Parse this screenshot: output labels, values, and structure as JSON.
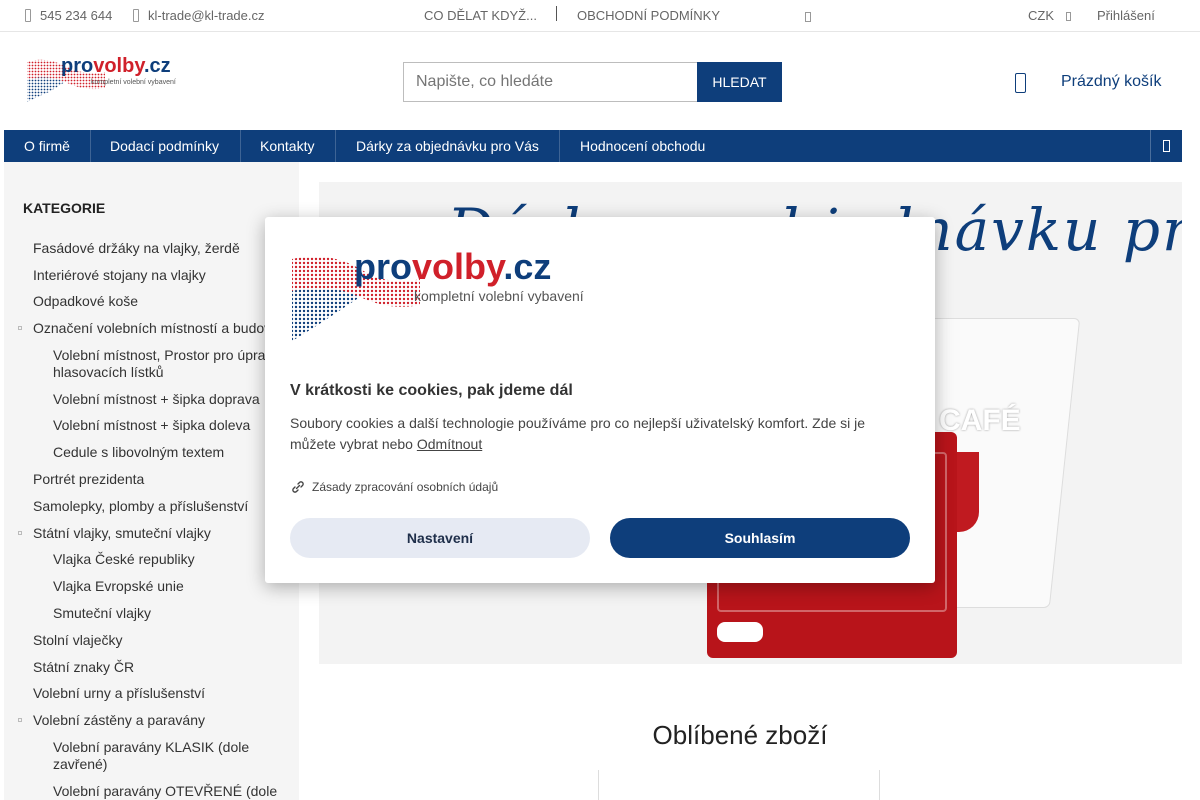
{
  "topbar": {
    "phone": "545 234 644",
    "email": "kl-trade@kl-trade.cz",
    "links": [
      "CO DĚLAT KDYŽ...",
      "OBCHODNÍ PODMÍNKY"
    ],
    "currency": "CZK",
    "login": "Přihlášení"
  },
  "logo": {
    "brand_part1": "pro",
    "brand_part2": "volby",
    "brand_part3": ".cz",
    "tagline": "kompletní volební vybavení"
  },
  "search": {
    "placeholder": "Napište, co hledáte",
    "button": "HLEDAT"
  },
  "cart": {
    "label": "Prázdný košík"
  },
  "nav": {
    "items": [
      "O firmě",
      "Dodací podmínky",
      "Kontakty",
      "Dárky za objednávku pro Vás",
      "Hodnocení obchodu"
    ]
  },
  "sidebar": {
    "title": "KATEGORIE",
    "categories": [
      "Fasádové držáky na vlajky, žerdě",
      "Interiérové stojany na vlajky",
      "Odpadkové koše",
      "Označení volebních místností a budov",
      "Volební místnost, Prostor pro úpravu hlasovacích lístků",
      "Volební místnost + šipka doprava",
      "Volební místnost + šipka doleva",
      "Cedule s libovolným textem",
      "Portrét prezidenta",
      "Samolepky, plomby a příslušenství",
      "Státní vlajky, smuteční vlajky",
      "Vlajka České republiky",
      "Vlajka Evropské unie",
      "Smuteční vlajky",
      "Stolní vlaječky",
      "Státní znaky ČR",
      "Volební urny a příslušenství",
      "Volební zástěny a paravány",
      "Volební paravány KLASIK (dole zavřené)",
      "Volební paravány OTEVŘENÉ (dole"
    ]
  },
  "banner": {
    "title": "Dárky za objednávku pro Vás:",
    "product_text": "CAFÉ"
  },
  "favorites": {
    "title": "Oblíbené zboží"
  },
  "cookie": {
    "heading": "V krátkosti ke cookies, pak jdeme dál",
    "text": "Soubory cookies a další technologie používáme pro co nejlepší uživatelský komfort. Zde si je můžete vybrat nebo",
    "reject_link": "Odmítnout",
    "policy_link": "Zásady zpracování osobních údajů",
    "settings_button": "Nastavení",
    "accept_button": "Souhlasím"
  },
  "colors": {
    "brand": "#0e3e7b",
    "accent_red": "#d0202a"
  }
}
